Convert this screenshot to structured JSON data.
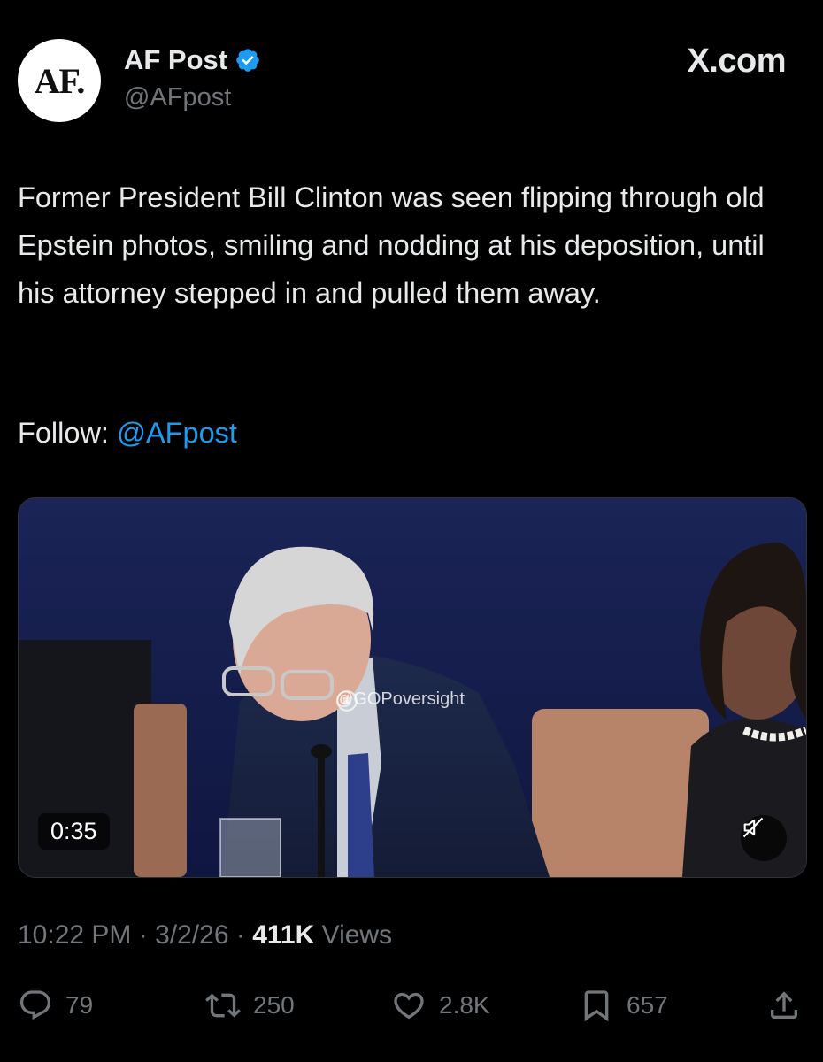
{
  "account": {
    "avatar_text": "AF.",
    "display_name": "AF Post",
    "handle": "@AFpost",
    "verified": true
  },
  "source_label": "X.com",
  "tweet": {
    "text": "Former President Bill Clinton was seen flipping through old Epstein photos, smiling and nodding at his deposition, until his attorney stepped in and pulled them away.",
    "follow_prefix": "Follow: ",
    "follow_link": "@AFpost"
  },
  "media": {
    "duration": "0:35",
    "watermark": "@GOPoversight",
    "muted": true
  },
  "meta": {
    "time": "10:22 PM",
    "date": "3/2/26",
    "views_count": "411K",
    "views_label": "Views"
  },
  "actions": {
    "replies": "79",
    "reposts": "250",
    "likes": "2.8K",
    "bookmarks": "657"
  },
  "colors": {
    "background": "#000000",
    "text": "#e7e9ea",
    "secondary": "#71767b",
    "link": "#1d9bf0",
    "verified": "#1d9bf0"
  }
}
